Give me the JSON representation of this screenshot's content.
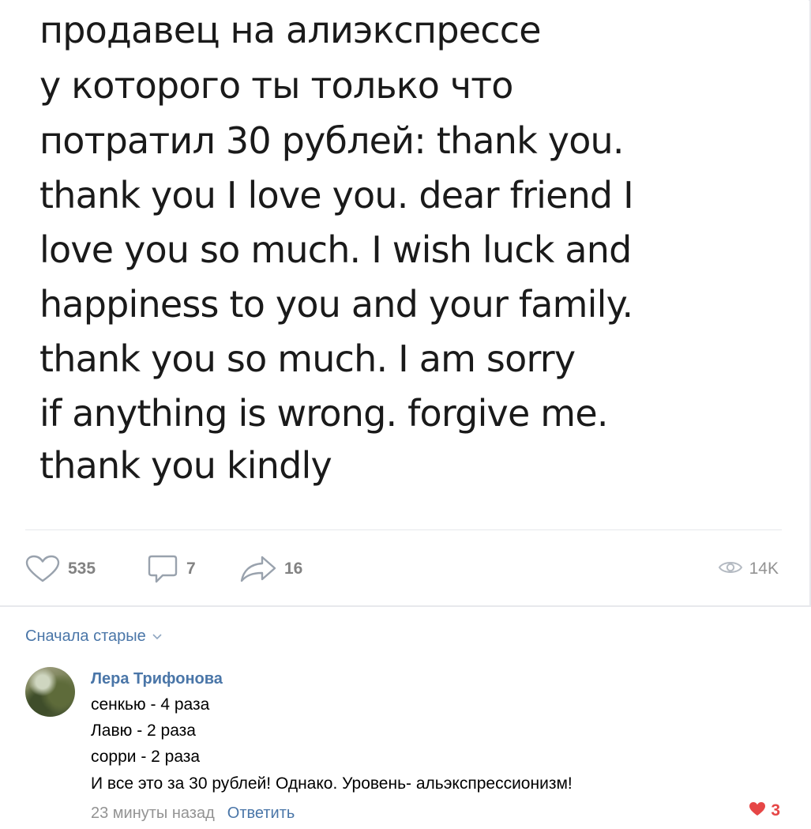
{
  "post": {
    "lines": [
      "продавец на алиэкспрессе",
      "у которого ты только что",
      "потратил 30 рублей: thank you.",
      "thank you I love you. dear friend I",
      "love you so much. I wish luck and",
      "happiness to you and your family.",
      "thank you so much. I am sorry",
      "if anything is wrong. forgive me.",
      "thank you kindly"
    ]
  },
  "actions": {
    "likes": "535",
    "comments": "7",
    "shares": "16",
    "views": "14K"
  },
  "comments_section": {
    "sort_label": "Сначала старые"
  },
  "comment": {
    "author": "Лера Трифонова",
    "lines": [
      "сенкью - 4 раза",
      "Лавю - 2 раза",
      "сорри - 2 раза",
      "И все это за 30 рублей! Однако. Уровень- альэкспрессионизм!"
    ],
    "time": "23 минуты назад",
    "reply_label": "Ответить",
    "likes": "3"
  },
  "colors": {
    "link": "#4a76a8",
    "muted": "#828282",
    "like_active": "#e64646"
  },
  "icons": [
    "heart-icon",
    "comment-icon",
    "share-icon",
    "eye-icon",
    "chevron-down-icon",
    "heart-filled-icon"
  ]
}
